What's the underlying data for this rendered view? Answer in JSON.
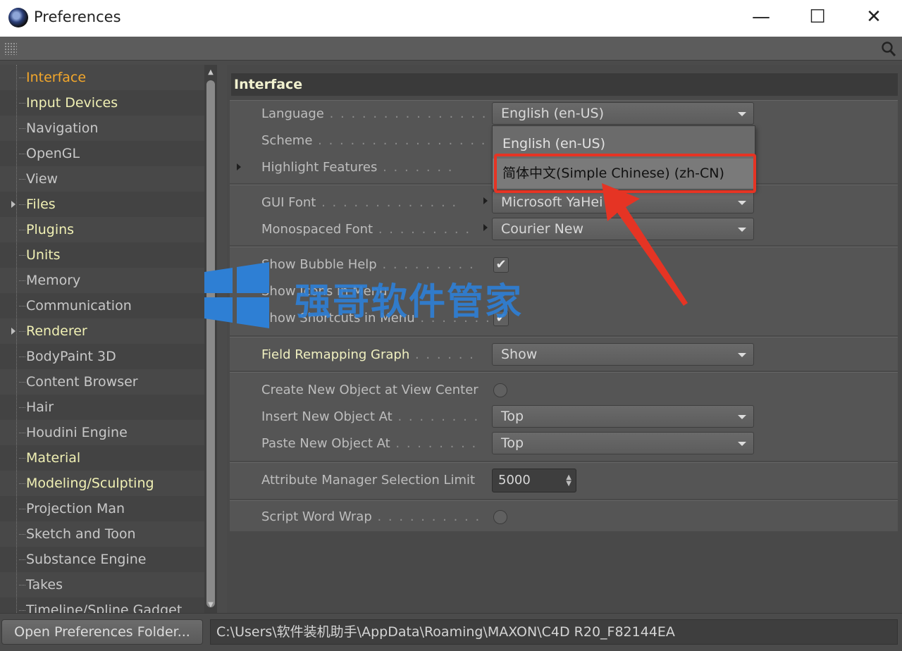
{
  "window": {
    "title": "Preferences",
    "minimize": "—",
    "maximize": "☐",
    "close": "✕"
  },
  "sidebar": {
    "items": [
      {
        "label": "Interface",
        "state": "active"
      },
      {
        "label": "Input Devices",
        "state": "bright"
      },
      {
        "label": "Navigation"
      },
      {
        "label": "OpenGL"
      },
      {
        "label": "View"
      },
      {
        "label": "Files",
        "state": "bright",
        "expandable": true
      },
      {
        "label": "Plugins",
        "state": "bright"
      },
      {
        "label": "Units",
        "state": "bright"
      },
      {
        "label": "Memory"
      },
      {
        "label": "Communication"
      },
      {
        "label": "Renderer",
        "state": "bright",
        "expandable": true
      },
      {
        "label": "BodyPaint 3D"
      },
      {
        "label": "Content Browser"
      },
      {
        "label": "Hair"
      },
      {
        "label": "Houdini Engine"
      },
      {
        "label": "Material",
        "state": "bright"
      },
      {
        "label": "Modeling/Sculpting",
        "state": "bright"
      },
      {
        "label": "Projection Man"
      },
      {
        "label": "Sketch and Toon"
      },
      {
        "label": "Substance Engine"
      },
      {
        "label": "Takes"
      },
      {
        "label": "Timeline/Spline Gadget"
      }
    ]
  },
  "main": {
    "header": "Interface",
    "language": {
      "label": "Language",
      "value": "English (en-US)"
    },
    "scheme": {
      "label": "Scheme"
    },
    "highlight": {
      "label": "Highlight Features"
    },
    "language_menu": {
      "options": [
        "English (en-US)",
        "简体中文(Simple Chinese) (zh-CN)"
      ]
    },
    "gui_font": {
      "label": "GUI Font",
      "value": "Microsoft YaHei UI"
    },
    "mono_font": {
      "label": "Monospaced Font",
      "value": "Courier New"
    },
    "bubble_help": {
      "label": "Show Bubble Help",
      "checked": "✔"
    },
    "icons_menu": {
      "label": "Show Icons in Menu"
    },
    "shortcuts_menu": {
      "label": "Show Shortcuts in Menu",
      "checked": "✔"
    },
    "field_remap": {
      "label": "Field Remapping Graph",
      "value": "Show"
    },
    "create_center": {
      "label": "Create New Object at View Center"
    },
    "insert_at": {
      "label": "Insert New Object At",
      "value": "Top"
    },
    "paste_at": {
      "label": "Paste New Object At",
      "value": "Top"
    },
    "selection_limit": {
      "label": "Attribute Manager Selection Limit",
      "value": "5000"
    },
    "word_wrap": {
      "label": "Script Word Wrap"
    }
  },
  "watermark": {
    "text": "强哥软件管家"
  },
  "footer": {
    "folder_button": "Open Preferences Folder...",
    "path": "C:\\Users\\软件装机助手\\AppData\\Roaming\\MAXON\\C4D R20_F82144EA"
  },
  "colors": {
    "active": "#f3a72b",
    "bright": "#f0f0b4",
    "highlight_box": "#e53424",
    "watermark": "#2e7fd4"
  }
}
